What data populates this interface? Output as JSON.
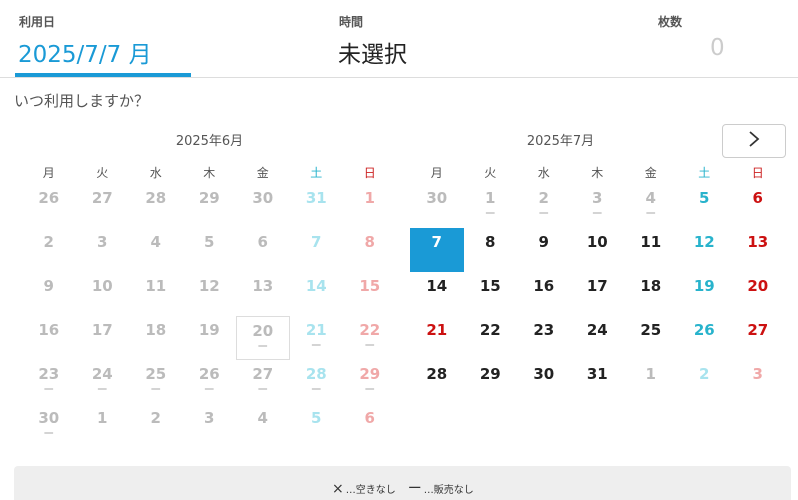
{
  "header": {
    "date_label": "利用日",
    "date_value": "2025/7/7 月",
    "time_label": "時間",
    "time_value": "未選択",
    "count_label": "枚数",
    "count_value": "0"
  },
  "prompt": "いつ利用しますか？",
  "next_button_icon": "chevron-right-icon",
  "weekdays": [
    "月",
    "火",
    "水",
    "木",
    "金",
    "土",
    "日"
  ],
  "colors": {
    "accent": "#1a9ad6",
    "saturday": "#28b3cc",
    "sunday": "#cc1111"
  },
  "months": [
    {
      "title": "2025年6月",
      "weeks": [
        [
          {
            "d": "26",
            "s": "other",
            "m": ""
          },
          {
            "d": "27",
            "s": "other",
            "m": ""
          },
          {
            "d": "28",
            "s": "other",
            "m": ""
          },
          {
            "d": "29",
            "s": "other",
            "m": ""
          },
          {
            "d": "30",
            "s": "other",
            "m": ""
          },
          {
            "d": "31",
            "s": "other",
            "m": ""
          },
          {
            "d": "1",
            "s": "other",
            "m": ""
          }
        ],
        [
          {
            "d": "2",
            "s": "other",
            "m": ""
          },
          {
            "d": "3",
            "s": "other",
            "m": ""
          },
          {
            "d": "4",
            "s": "other",
            "m": ""
          },
          {
            "d": "5",
            "s": "other",
            "m": ""
          },
          {
            "d": "6",
            "s": "other",
            "m": ""
          },
          {
            "d": "7",
            "s": "other",
            "m": ""
          },
          {
            "d": "8",
            "s": "other",
            "m": ""
          }
        ],
        [
          {
            "d": "9",
            "s": "other",
            "m": ""
          },
          {
            "d": "10",
            "s": "other",
            "m": ""
          },
          {
            "d": "11",
            "s": "other",
            "m": ""
          },
          {
            "d": "12",
            "s": "other",
            "m": ""
          },
          {
            "d": "13",
            "s": "other",
            "m": ""
          },
          {
            "d": "14",
            "s": "other",
            "m": ""
          },
          {
            "d": "15",
            "s": "other",
            "m": ""
          }
        ],
        [
          {
            "d": "16",
            "s": "other",
            "m": ""
          },
          {
            "d": "17",
            "s": "other",
            "m": ""
          },
          {
            "d": "18",
            "s": "other",
            "m": ""
          },
          {
            "d": "19",
            "s": "other",
            "m": ""
          },
          {
            "d": "20",
            "s": "other today",
            "m": "ー"
          },
          {
            "d": "21",
            "s": "other",
            "m": "ー"
          },
          {
            "d": "22",
            "s": "other",
            "m": "ー"
          }
        ],
        [
          {
            "d": "23",
            "s": "other",
            "m": "ー"
          },
          {
            "d": "24",
            "s": "other",
            "m": "ー"
          },
          {
            "d": "25",
            "s": "other",
            "m": "ー"
          },
          {
            "d": "26",
            "s": "other",
            "m": "ー"
          },
          {
            "d": "27",
            "s": "other",
            "m": "ー"
          },
          {
            "d": "28",
            "s": "other",
            "m": "ー"
          },
          {
            "d": "29",
            "s": "other",
            "m": "ー"
          }
        ],
        [
          {
            "d": "30",
            "s": "other",
            "m": "ー"
          },
          {
            "d": "1",
            "s": "other",
            "m": ""
          },
          {
            "d": "2",
            "s": "other",
            "m": ""
          },
          {
            "d": "3",
            "s": "other",
            "m": ""
          },
          {
            "d": "4",
            "s": "other",
            "m": ""
          },
          {
            "d": "5",
            "s": "other",
            "m": ""
          },
          {
            "d": "6",
            "s": "other",
            "m": ""
          }
        ]
      ]
    },
    {
      "title": "2025年7月",
      "weeks": [
        [
          {
            "d": "30",
            "s": "other",
            "m": ""
          },
          {
            "d": "1",
            "s": "other",
            "m": "ー"
          },
          {
            "d": "2",
            "s": "other",
            "m": "ー"
          },
          {
            "d": "3",
            "s": "other",
            "m": "ー"
          },
          {
            "d": "4",
            "s": "other",
            "m": "ー"
          },
          {
            "d": "5",
            "s": "active",
            "m": ""
          },
          {
            "d": "6",
            "s": "active",
            "m": ""
          }
        ],
        [
          {
            "d": "7",
            "s": "active selected",
            "m": ""
          },
          {
            "d": "8",
            "s": "active",
            "m": ""
          },
          {
            "d": "9",
            "s": "active",
            "m": ""
          },
          {
            "d": "10",
            "s": "active",
            "m": ""
          },
          {
            "d": "11",
            "s": "active",
            "m": ""
          },
          {
            "d": "12",
            "s": "active",
            "m": ""
          },
          {
            "d": "13",
            "s": "active",
            "m": ""
          }
        ],
        [
          {
            "d": "14",
            "s": "active",
            "m": ""
          },
          {
            "d": "15",
            "s": "active",
            "m": ""
          },
          {
            "d": "16",
            "s": "active",
            "m": ""
          },
          {
            "d": "17",
            "s": "active",
            "m": ""
          },
          {
            "d": "18",
            "s": "active",
            "m": ""
          },
          {
            "d": "19",
            "s": "active",
            "m": ""
          },
          {
            "d": "20",
            "s": "active",
            "m": ""
          }
        ],
        [
          {
            "d": "21",
            "s": "active sun-holiday",
            "m": ""
          },
          {
            "d": "22",
            "s": "active",
            "m": ""
          },
          {
            "d": "23",
            "s": "active",
            "m": ""
          },
          {
            "d": "24",
            "s": "active",
            "m": ""
          },
          {
            "d": "25",
            "s": "active",
            "m": ""
          },
          {
            "d": "26",
            "s": "active",
            "m": ""
          },
          {
            "d": "27",
            "s": "active",
            "m": ""
          }
        ],
        [
          {
            "d": "28",
            "s": "active",
            "m": ""
          },
          {
            "d": "29",
            "s": "active",
            "m": ""
          },
          {
            "d": "30",
            "s": "active",
            "m": ""
          },
          {
            "d": "31",
            "s": "active",
            "m": ""
          },
          {
            "d": "1",
            "s": "other",
            "m": ""
          },
          {
            "d": "2",
            "s": "other",
            "m": ""
          },
          {
            "d": "3",
            "s": "other",
            "m": ""
          }
        ]
      ]
    }
  ],
  "legend": {
    "unavailable_symbol": "×",
    "unavailable_text": "…空きなし",
    "no_sale_symbol": "ー",
    "no_sale_text": "…販売なし"
  }
}
